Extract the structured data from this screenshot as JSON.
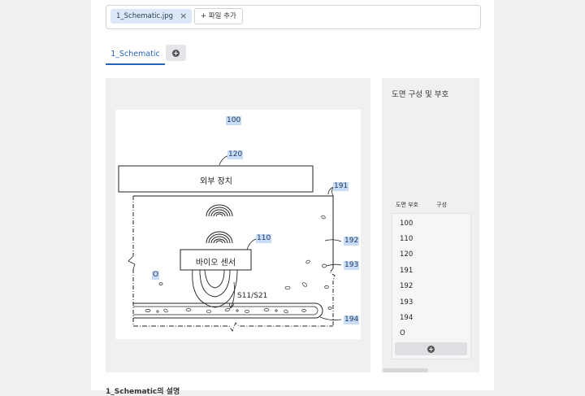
{
  "files": {
    "chip_label": "1_Schematic.jpg",
    "add_label": "+ 파일 추가"
  },
  "tabs": [
    {
      "label": "1_Schematic"
    }
  ],
  "drawing": {
    "labels": {
      "l100": "100",
      "l120": "120",
      "l191": "191",
      "l110": "110",
      "l192": "192",
      "l193": "193",
      "l194": "194",
      "lO": "O"
    },
    "box_external": "외부 장치",
    "box_sensor": "바이오 센서",
    "signal_text": "S11/S21"
  },
  "side": {
    "title": "도면 구성 및 부호",
    "col_code": "도면 부호",
    "col_part": "구성",
    "rows": [
      "100",
      "110",
      "120",
      "191",
      "192",
      "193",
      "194",
      "O"
    ]
  },
  "caption": "1_Schematic의 설명",
  "colors": {
    "accent": "#2a62b8",
    "label_highlight": "#c9dcf5"
  }
}
